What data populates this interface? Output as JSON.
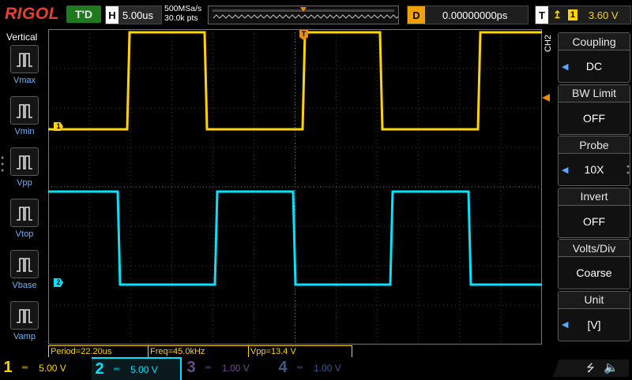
{
  "header": {
    "brand": "RIGOL",
    "run_status": "T'D",
    "horizontal_tag": "H",
    "timebase": "5.00us",
    "sample_rate": "500MSa/s",
    "memory_depth": "30.0k pts",
    "delay_tag": "D",
    "delay": "0.00000000ps",
    "trigger_tag": "T",
    "trigger_source": "1",
    "trigger_level": "3.60 V"
  },
  "left_panel": {
    "title": "Vertical",
    "items": [
      {
        "label": "Vmax",
        "icon": "vmax-icon"
      },
      {
        "label": "Vmin",
        "icon": "vmin-icon"
      },
      {
        "label": "Vpp",
        "icon": "vpp-icon"
      },
      {
        "label": "Vtop",
        "icon": "vtop-icon"
      },
      {
        "label": "Vbase",
        "icon": "vbase-icon"
      },
      {
        "label": "Vamp",
        "icon": "vamp-icon"
      }
    ]
  },
  "menu": {
    "channel": "CH2",
    "items": [
      {
        "title": "Coupling",
        "value": "DC",
        "arrow": true
      },
      {
        "title": "BW Limit",
        "value": "OFF",
        "arrow": false
      },
      {
        "title": "Probe",
        "value": "10X",
        "arrow": true
      },
      {
        "title": "Invert",
        "value": "OFF",
        "arrow": false
      },
      {
        "title": "Volts/Div",
        "value": "Coarse",
        "arrow": false
      },
      {
        "title": "Unit",
        "value": "[V]",
        "arrow": true
      }
    ]
  },
  "measurements": {
    "period": "Period=22.20us",
    "freq": "Freq=45.0kHz",
    "vpp": "Vpp=13.4 V"
  },
  "channels": [
    {
      "num": "1",
      "scale": "5.00 V",
      "color": "#ffd400",
      "active": true
    },
    {
      "num": "2",
      "scale": "5.00 V",
      "color": "#00e5ff",
      "active": true
    },
    {
      "num": "3",
      "scale": "1.00 V",
      "color": "#6a4a8a",
      "active": false
    },
    {
      "num": "4",
      "scale": "1.00 V",
      "color": "#3a5a8a",
      "active": false
    }
  ],
  "markers": {
    "ch1": "1",
    "ch2": "2",
    "trigger": "T"
  },
  "colors": {
    "ch1": "#ffd400",
    "ch2": "#00e5ff",
    "accent": "#5aa8ff",
    "trigger": "#f08a00"
  }
}
